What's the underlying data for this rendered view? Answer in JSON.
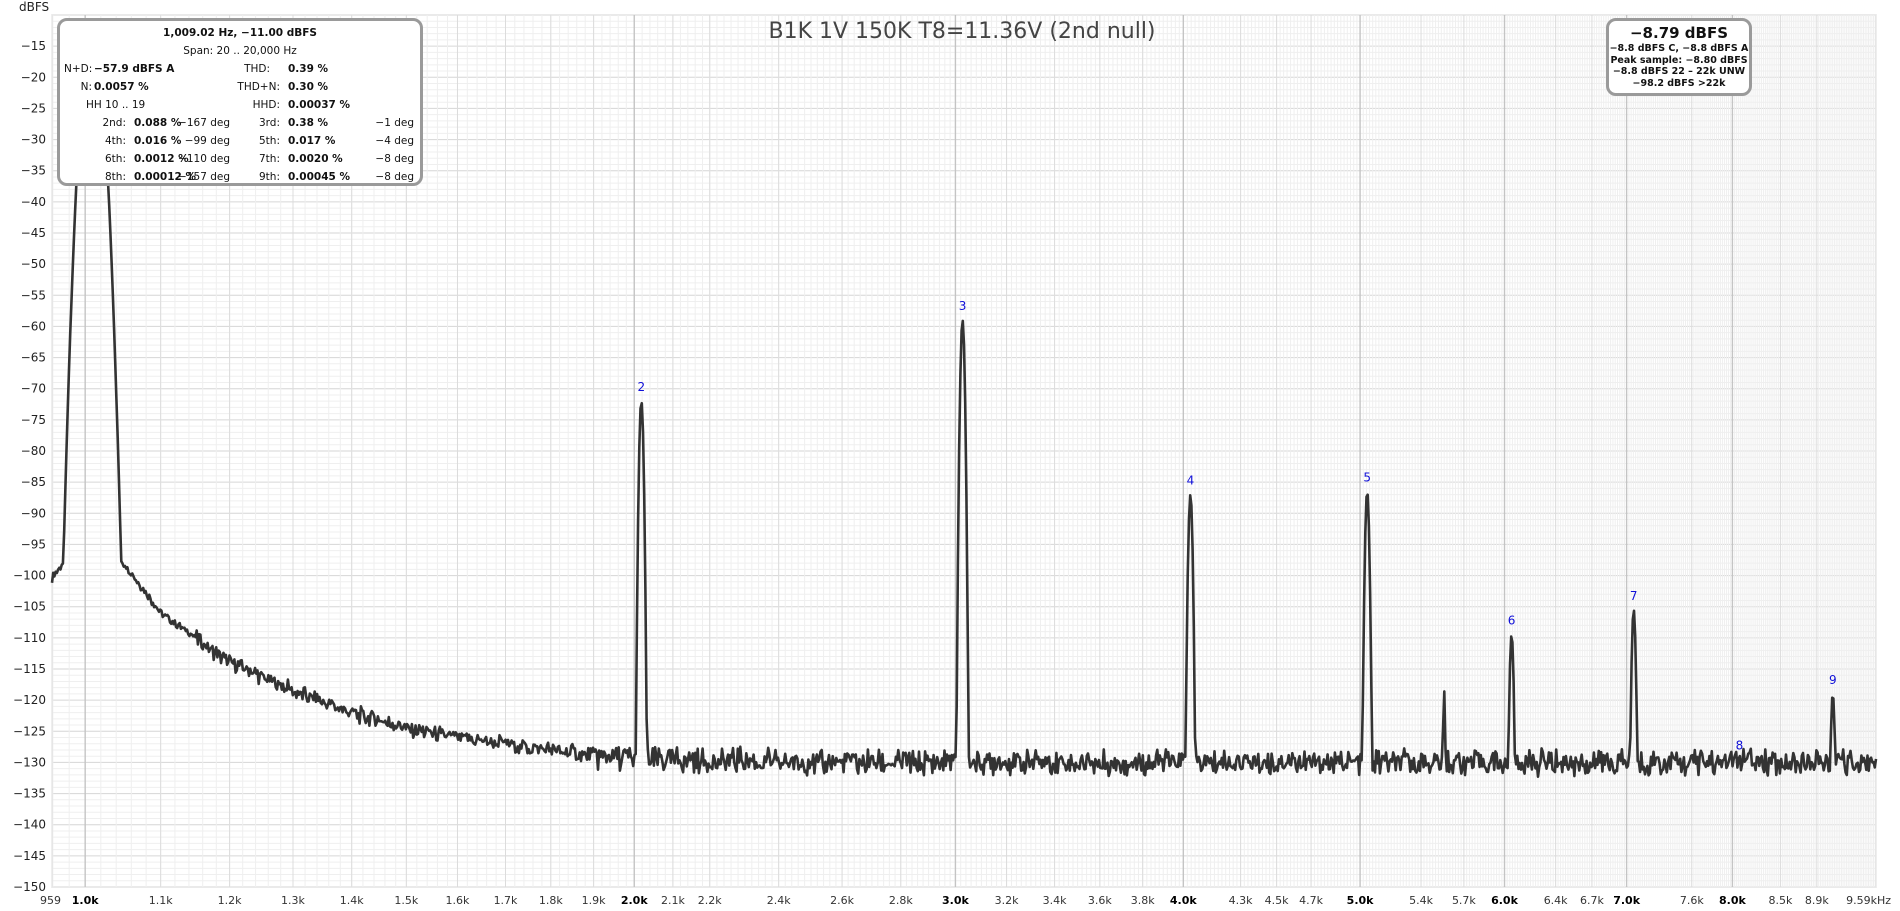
{
  "title": "B1K 1V 150K T8=11.36V (2nd null)",
  "y_unit": "dBFS",
  "x_unit": "kHz",
  "stats": {
    "fundamental": "1,009.02 Hz, −11.00 dBFS",
    "span": "Span: 20 .. 20,000 Hz",
    "nd_label": "N+D:",
    "nd_value": "−57.9 dBFS A",
    "thd_label": "THD:",
    "thd_value": "0.39 %",
    "n_label": "N:",
    "n_value": "0.0057 %",
    "thdn_label": "THD+N:",
    "thdn_value": "0.30 %",
    "hh": "HH 10 .. 19",
    "hhd_label": "HHD:",
    "hhd_value": "0.00037 %",
    "harmonics": [
      {
        "l1": "2nd:",
        "v1": "0.088 %",
        "d1": "−167 deg",
        "l2": "3rd:",
        "v2": "0.38 %",
        "d2": "−1 deg"
      },
      {
        "l1": "4th:",
        "v1": "0.016 %",
        "d1": "−99 deg",
        "l2": "5th:",
        "v2": "0.017 %",
        "d2": "−4 deg"
      },
      {
        "l1": "6th:",
        "v1": "0.0012 %",
        "d1": "−110 deg",
        "l2": "7th:",
        "v2": "0.0020 %",
        "d2": "−8 deg"
      },
      {
        "l1": "8th:",
        "v1": "0.00012 %",
        "d1": "−157 deg",
        "l2": "9th:",
        "v2": "0.00045 %",
        "d2": "−8 deg"
      }
    ]
  },
  "level": {
    "main": "−8.79 dBFS",
    "line1": "−8.8 dBFS C, −8.8 dBFS A",
    "line2": "Peak sample: −8.80 dBFS",
    "line3": "−8.8 dBFS 22 – 22k UNW",
    "line4": "−98.2 dBFS >22k"
  },
  "colors": {
    "trace": "#333333",
    "marker": "#1010d8",
    "grid": "#e3e3e3",
    "grid_major": "#c4c4c4",
    "box_border": "#9a9a9a"
  },
  "chart_data": {
    "type": "line",
    "title": "B1K 1V 150K T8=11.36V (2nd null)",
    "ylabel": "dBFS",
    "xlabel": "kHz",
    "x_scale": "log",
    "xlim": [
      959,
      9590
    ],
    "ylim": [
      -150,
      -10
    ],
    "grid": true,
    "y_ticks": [
      -15,
      -20,
      -25,
      -30,
      -35,
      -40,
      -45,
      -50,
      -55,
      -60,
      -65,
      -70,
      -75,
      -80,
      -85,
      -90,
      -95,
      -100,
      -105,
      -110,
      -115,
      -120,
      -125,
      -130,
      -135,
      -140,
      -145,
      -150
    ],
    "x_ticks": [
      {
        "v": 959,
        "label": "959",
        "major": false
      },
      {
        "v": 1000,
        "label": "1.0k",
        "major": true
      },
      {
        "v": 1100,
        "label": "1.1k",
        "major": false
      },
      {
        "v": 1200,
        "label": "1.2k",
        "major": false
      },
      {
        "v": 1300,
        "label": "1.3k",
        "major": false
      },
      {
        "v": 1400,
        "label": "1.4k",
        "major": false
      },
      {
        "v": 1500,
        "label": "1.5k",
        "major": false
      },
      {
        "v": 1600,
        "label": "1.6k",
        "major": false
      },
      {
        "v": 1700,
        "label": "1.7k",
        "major": false
      },
      {
        "v": 1800,
        "label": "1.8k",
        "major": false
      },
      {
        "v": 1900,
        "label": "1.9k",
        "major": false
      },
      {
        "v": 2000,
        "label": "2.0k",
        "major": true
      },
      {
        "v": 2100,
        "label": "2.1k",
        "major": false
      },
      {
        "v": 2200,
        "label": "2.2k",
        "major": false
      },
      {
        "v": 2400,
        "label": "2.4k",
        "major": false
      },
      {
        "v": 2600,
        "label": "2.6k",
        "major": false
      },
      {
        "v": 2800,
        "label": "2.8k",
        "major": false
      },
      {
        "v": 3000,
        "label": "3.0k",
        "major": true
      },
      {
        "v": 3200,
        "label": "3.2k",
        "major": false
      },
      {
        "v": 3400,
        "label": "3.4k",
        "major": false
      },
      {
        "v": 3600,
        "label": "3.6k",
        "major": false
      },
      {
        "v": 3800,
        "label": "3.8k",
        "major": false
      },
      {
        "v": 4000,
        "label": "4.0k",
        "major": true
      },
      {
        "v": 4300,
        "label": "4.3k",
        "major": false
      },
      {
        "v": 4500,
        "label": "4.5k",
        "major": false
      },
      {
        "v": 4700,
        "label": "4.7k",
        "major": false
      },
      {
        "v": 5000,
        "label": "5.0k",
        "major": true
      },
      {
        "v": 5400,
        "label": "5.4k",
        "major": false
      },
      {
        "v": 5700,
        "label": "5.7k",
        "major": false
      },
      {
        "v": 6000,
        "label": "6.0k",
        "major": true
      },
      {
        "v": 6400,
        "label": "6.4k",
        "major": false
      },
      {
        "v": 6700,
        "label": "6.7k",
        "major": false
      },
      {
        "v": 7000,
        "label": "7.0k",
        "major": true
      },
      {
        "v": 7600,
        "label": "7.6k",
        "major": false
      },
      {
        "v": 8000,
        "label": "8.0k",
        "major": true
      },
      {
        "v": 8500,
        "label": "8.5k",
        "major": false
      },
      {
        "v": 8900,
        "label": "8.9k",
        "major": false
      },
      {
        "v": 9590,
        "label": "9.59kHz",
        "major": false
      }
    ],
    "fundamental": {
      "x": 1009,
      "y": -11.0
    },
    "harmonic_markers": [
      {
        "label": "2",
        "x": 2018,
        "y": -72
      },
      {
        "label": "3",
        "x": 3027,
        "y": -59
      },
      {
        "label": "4",
        "x": 4036,
        "y": -87
      },
      {
        "label": "5",
        "x": 5045,
        "y": -86.5
      },
      {
        "label": "6",
        "x": 6054,
        "y": -109.5
      },
      {
        "label": "7",
        "x": 7063,
        "y": -105.5
      },
      {
        "label": "8",
        "x": 8072,
        "y": -129.5
      },
      {
        "label": "9",
        "x": 9081,
        "y": -119
      }
    ],
    "extra_peaks": [
      {
        "x": 5560,
        "y": -118.5
      }
    ],
    "noise_floor": [
      {
        "x": 959,
        "y": -100.5
      },
      {
        "x": 980,
        "y": -96.5
      },
      {
        "x": 1030,
        "y": -96
      },
      {
        "x": 1050,
        "y": -98
      },
      {
        "x": 1100,
        "y": -106
      },
      {
        "x": 1150,
        "y": -110
      },
      {
        "x": 1200,
        "y": -114
      },
      {
        "x": 1300,
        "y": -118.5
      },
      {
        "x": 1400,
        "y": -122
      },
      {
        "x": 1500,
        "y": -124.5
      },
      {
        "x": 1600,
        "y": -126
      },
      {
        "x": 1700,
        "y": -127
      },
      {
        "x": 1800,
        "y": -128
      },
      {
        "x": 1900,
        "y": -129
      },
      {
        "x": 2000,
        "y": -129.5
      },
      {
        "x": 2500,
        "y": -130
      },
      {
        "x": 9590,
        "y": -130
      }
    ]
  }
}
